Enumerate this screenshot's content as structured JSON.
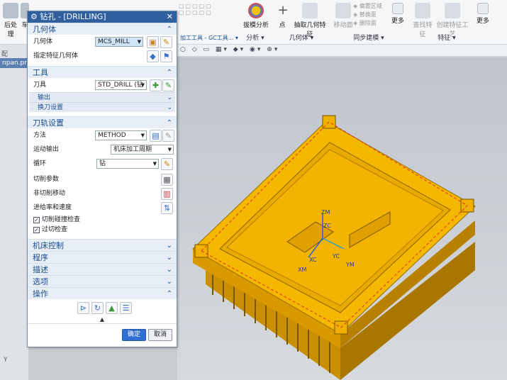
{
  "ribbon": {
    "left_items": [
      "后处理",
      "车"
    ],
    "gongju_label": "加工工具 - GC工具...",
    "analysis_label": "拔模分析",
    "analysis_group": "分析",
    "point_label": "点",
    "extract_label": "抽取几何特征",
    "geometry_group": "几何体",
    "move_face_label": "移动面",
    "offset_region_label": "偏置区域",
    "replace_face_label": "替换面",
    "delete_face_label": "删除面",
    "more_label": "更多",
    "sync_group": "同步建模",
    "find_feature_label": "查找特征",
    "create_process_label": "创建特征工艺",
    "more2_label": "更多",
    "feature_group": "特征"
  },
  "left": {
    "search_hint": "配",
    "file_tab": "npan.prt",
    "axis_y": "Y"
  },
  "dialog": {
    "title": "钻孔 - [DRILLING]",
    "geometry": {
      "header": "几何体",
      "geom_label": "几何体",
      "geom_value": "MCS_MILL",
      "feature_label": "指定特征几何体"
    },
    "tool": {
      "header": "工具",
      "tool_label": "刀具",
      "tool_value": "STD_DRILL (钻",
      "output_label": "输出",
      "change_label": "换刀设置"
    },
    "path": {
      "header": "刀轨设置",
      "method_label": "方法",
      "method_value": "METHOD",
      "motion_label": "运动输出",
      "motion_value": "机床加工周期",
      "cycle_label": "循环",
      "cycle_value": "钻",
      "cut_params": "切削参数",
      "noncut": "非切削移动",
      "feeds": "进给率和速度",
      "collision": "切削碰撞检查",
      "overcut": "过切检查"
    },
    "machine": "机床控制",
    "program": "程序",
    "description": "描述",
    "options": "选项",
    "actions": "操作",
    "ok": "确定",
    "cancel": "取消"
  },
  "viewport": {
    "zm": "ZM",
    "zc": "ZC",
    "yc": "YC",
    "ym": "YM",
    "xc": "XC",
    "xm": "XM"
  },
  "colors": {
    "part": "#f5b800",
    "title_bar": "#2f5f9d",
    "header_text": "#1a4f8f"
  }
}
